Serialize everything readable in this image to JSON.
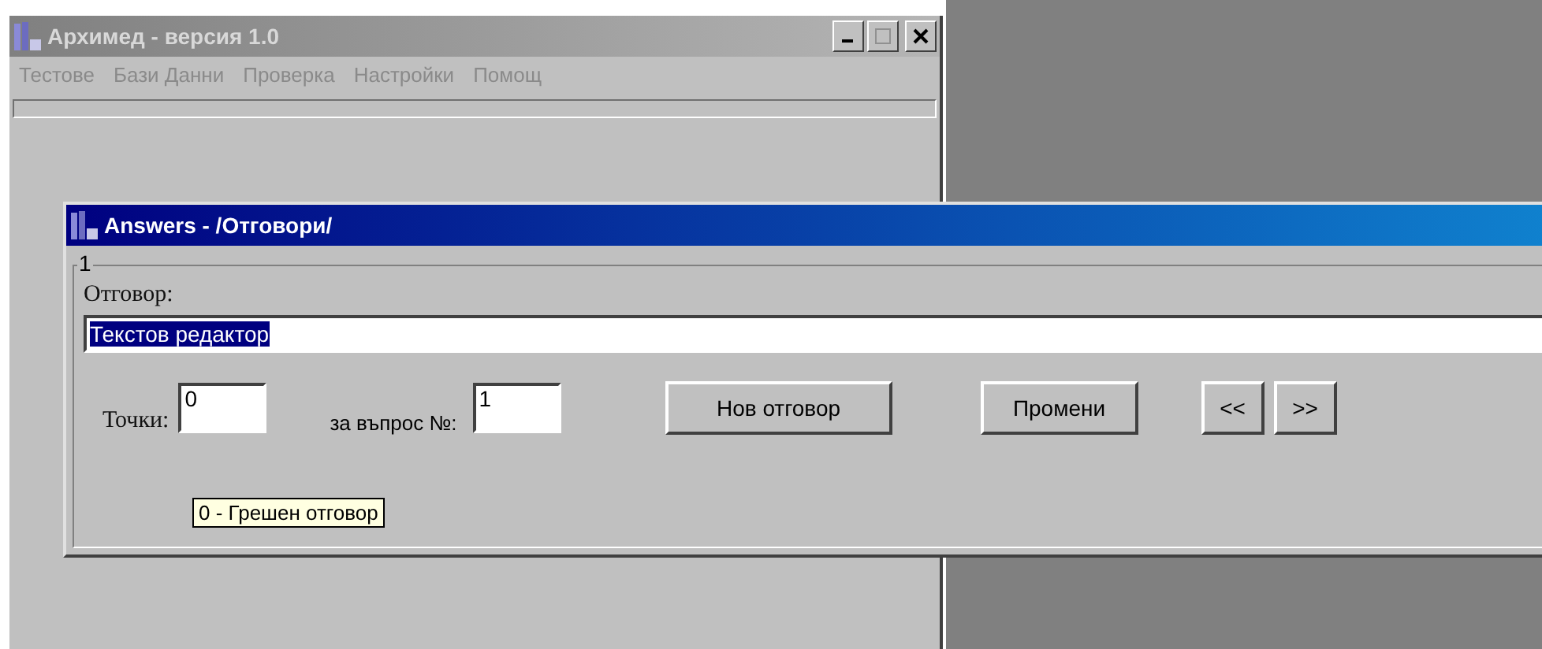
{
  "main_window": {
    "title": "Архимед - версия 1.0",
    "active": false,
    "menu": [
      "Тестове",
      "Бази Данни",
      "Проверка",
      "Настройки",
      "Помощ"
    ]
  },
  "dialog": {
    "title": "Answers - /Отговори/",
    "active": true,
    "group_label": "1",
    "answer_label": "Отговор:",
    "answer_value": "Текстов редактор",
    "answer_selected": true,
    "points_label": "Точки:",
    "points_value": "0",
    "question_label": "за въпрос №:",
    "question_value": "1",
    "buttons": [
      "Нов отговор",
      "Промени",
      "<<",
      ">>"
    ],
    "tooltip": "0 - Грешен отговор"
  }
}
